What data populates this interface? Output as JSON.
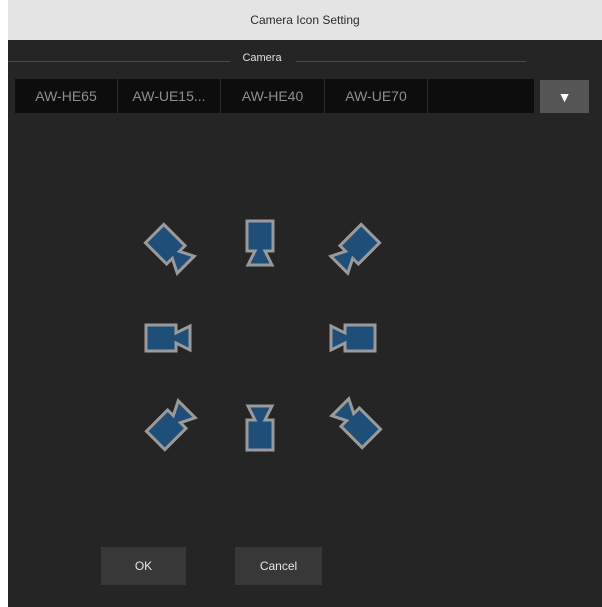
{
  "dialog": {
    "title": "Camera Icon Setting"
  },
  "camera_section": {
    "label": "Camera",
    "cameras": [
      "AW-HE65",
      "AW-UE15...",
      "AW-HE40",
      "AW-UE70",
      ""
    ],
    "dropdown_icon": "triangle-down-icon"
  },
  "icons": [
    {
      "name": "camera-icon-up-left",
      "selected": false
    },
    {
      "name": "camera-icon-up",
      "selected": false
    },
    {
      "name": "camera-icon-up-right",
      "selected": false
    },
    {
      "name": "camera-icon-left",
      "selected": false
    },
    {
      "name": "camera-icon-right",
      "selected": false
    },
    {
      "name": "camera-icon-down-left",
      "selected": false
    },
    {
      "name": "camera-icon-down",
      "selected": false
    },
    {
      "name": "camera-icon-down-right",
      "selected": false
    }
  ],
  "colors": {
    "icon_fill": "#1f4e78",
    "icon_stroke": "#9a9a9a"
  },
  "buttons": {
    "ok": "OK",
    "cancel": "Cancel"
  }
}
